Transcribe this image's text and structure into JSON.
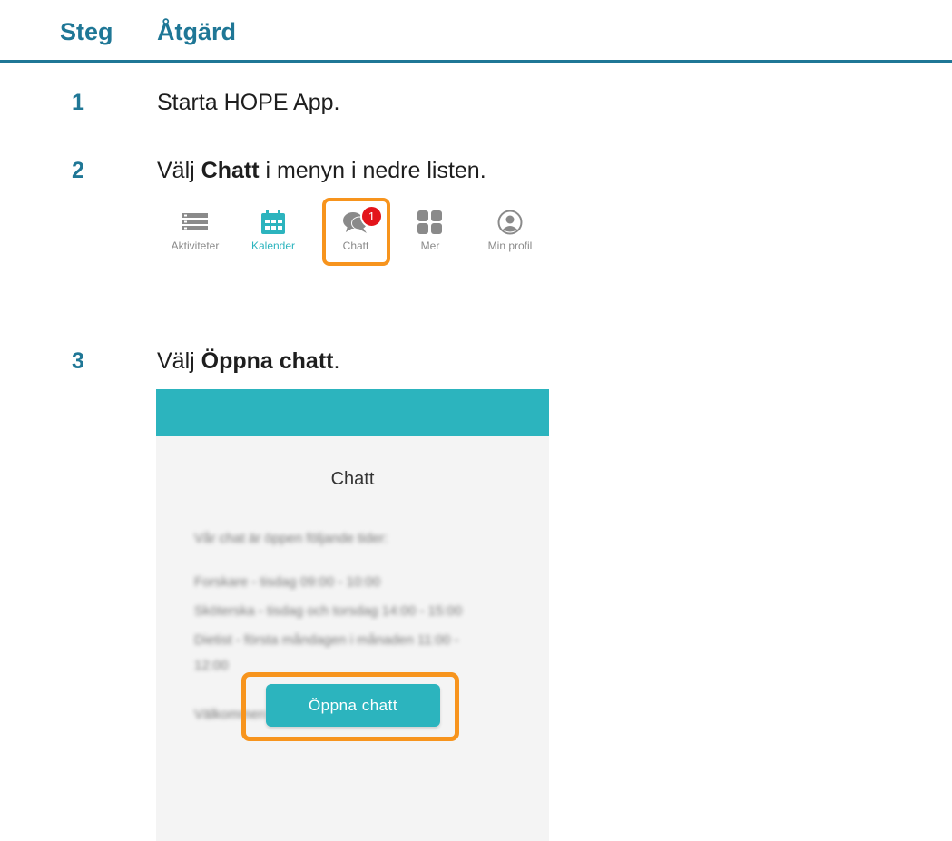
{
  "header": {
    "col1": "Steg",
    "col2": "Åtgärd"
  },
  "steps": [
    {
      "num": "1",
      "text": "Starta HOPE App."
    },
    {
      "num": "2",
      "pre": "Välj ",
      "bold": "Chatt",
      "post": " i menyn i nedre listen."
    },
    {
      "num": "3",
      "pre": "Välj ",
      "bold": "Öppna chatt",
      "post": "."
    }
  ],
  "tabbar": {
    "items": [
      {
        "label": "Aktiviteter",
        "icon": "list-icon"
      },
      {
        "label": "Kalender",
        "icon": "calendar-icon",
        "active": true
      },
      {
        "label": "Chatt",
        "icon": "chat-icon",
        "badge": "1"
      },
      {
        "label": "Mer",
        "icon": "grid-icon"
      },
      {
        "label": "Min profil",
        "icon": "profile-icon"
      }
    ]
  },
  "chat_screen": {
    "title": "Chatt",
    "blurred_lines": [
      "Vår chat är öppen följande tider:",
      "Forskare - tisdag 09:00 - 10:00",
      "Sköterska - tisdag och torsdag 14:00 - 15:00",
      "Dietist - första måndagen i månaden 11:00 -",
      "12:00",
      "Välkommen med dina frågor."
    ],
    "button": "Öppna chatt"
  },
  "colors": {
    "heading": "#1f7796",
    "accent": "#2cb4be",
    "highlight": "#f7941d",
    "badge": "#e3141b"
  }
}
